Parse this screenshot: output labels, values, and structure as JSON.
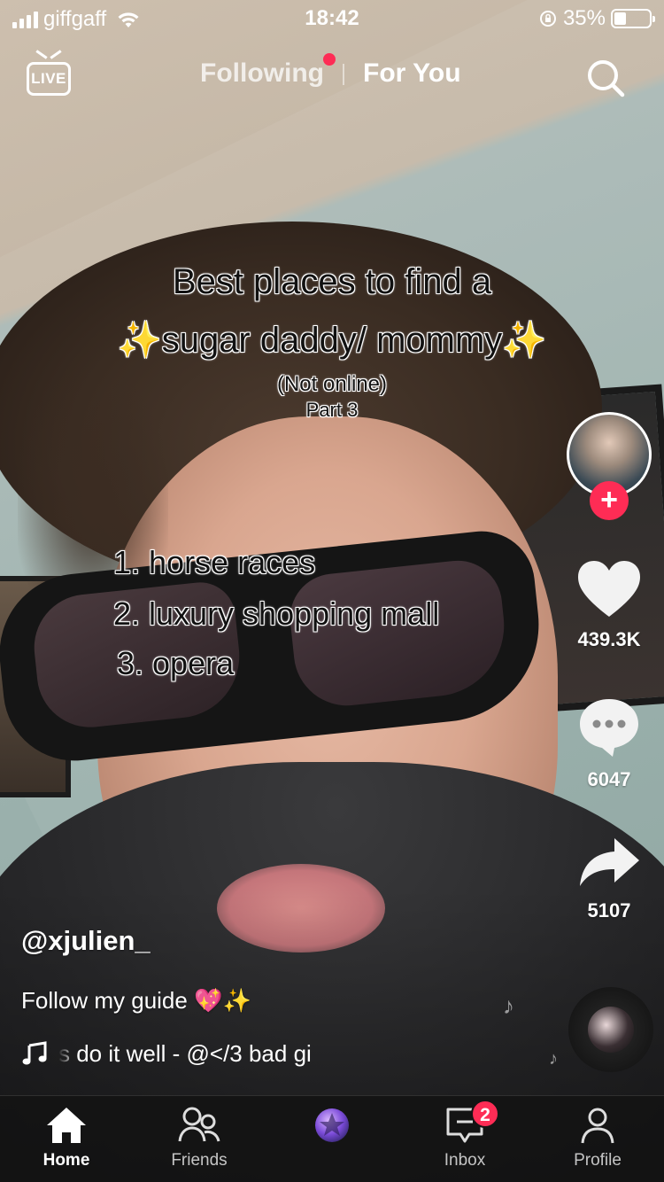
{
  "status_bar": {
    "carrier": "giffgaff",
    "time": "18:42",
    "battery_percent": "35%",
    "battery_level": 0.35
  },
  "top_nav": {
    "live_label": "LIVE",
    "tab_following": "Following",
    "tab_for_you": "For You",
    "icons": [
      "live-tv-icon",
      "search-icon"
    ]
  },
  "video_overlay": {
    "title_line1": "Best places to find a",
    "title_line2": "✨sugar daddy/ mommy✨",
    "subtitle_line1": "(Not online)",
    "subtitle_line2": "Part 3",
    "list": [
      "1. horse races",
      "2. luxury shopping mall",
      "3. opera"
    ]
  },
  "right_rail": {
    "likes": "439.3K",
    "comments": "6047",
    "shares": "5107",
    "icons": [
      "avatar",
      "follow-plus-icon",
      "heart-icon",
      "comment-icon",
      "share-icon",
      "music-disc"
    ]
  },
  "post": {
    "username": "@xjulien_",
    "description": "Follow my guide 💖✨",
    "music": "s do it well - @</3    bad gi"
  },
  "bottom_nav": {
    "home": "Home",
    "friends": "Friends",
    "inbox": "Inbox",
    "inbox_badge": "2",
    "profile": "Profile"
  },
  "colors": {
    "accent": "#fe2c55",
    "tabbar": "#141414"
  }
}
